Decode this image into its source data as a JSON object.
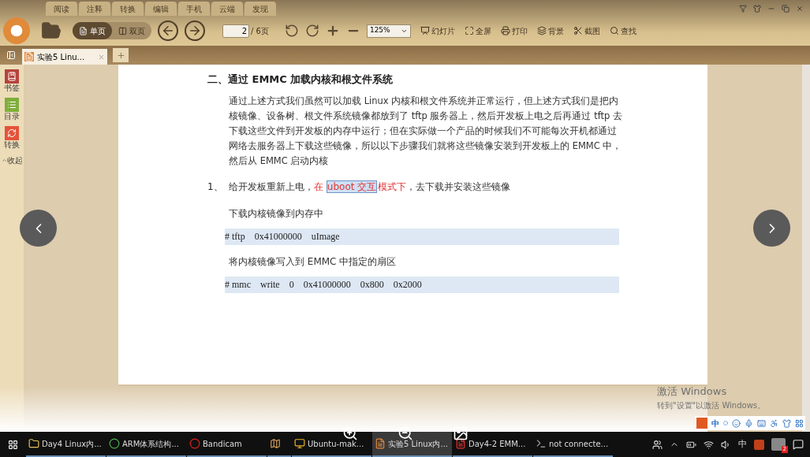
{
  "menu_tabs": [
    "阅读",
    "注释",
    "转换",
    "编辑",
    "手机",
    "云端",
    "发现"
  ],
  "toolbar": {
    "view_modes": [
      {
        "label": "单页",
        "selected": true
      },
      {
        "label": "双页",
        "selected": false
      }
    ],
    "page_input": "2",
    "page_total": "/ 6页",
    "zoom": "125%",
    "actions": [
      {
        "kind": "slideshow",
        "label": "幻灯片"
      },
      {
        "kind": "fullscreen",
        "label": "全屏"
      },
      {
        "kind": "print",
        "label": "打印"
      },
      {
        "kind": "background",
        "label": "背景"
      },
      {
        "kind": "screenshot",
        "label": "截图"
      },
      {
        "kind": "find",
        "label": "查找"
      }
    ]
  },
  "doc_tabs": [
    {
      "title": "实验5 Linu...",
      "selected": true
    }
  ],
  "sidebar": {
    "items": [
      {
        "kind": "bookmark",
        "label": "书签"
      },
      {
        "kind": "toc",
        "label": "目录"
      },
      {
        "kind": "convert",
        "label": "转换"
      }
    ],
    "collapse": "收起"
  },
  "document": {
    "heading": "二、通过 EMMC 加载内核和根文件系统",
    "paragraph": "通过上述方式我们虽然可以加载 Linux 内核和根文件系统并正常运行，但上述方式我们是把内核镜像、设备树、根文件系统镜像都放到了 tftp 服务器上，然后开发板上电之后再通过 tftp 去下载这些文件到开发板的内存中运行；但在实际做一个产品的时候我们不可能每次开机都通过网络去服务器上下载这些镜像，所以以下步骤我们就将这些镜像安装到开发板上的 EMMC 中，然后从 EMMC 启动内核",
    "step_number": "1、",
    "step": [
      {
        "kind": "plain",
        "text": "给开发板重新上电，"
      },
      {
        "kind": "annotated",
        "text": "在 "
      },
      {
        "kind": "selected",
        "text": "uboot 交互"
      },
      {
        "kind": "annotated",
        "text": "模式下"
      },
      {
        "kind": "plain",
        "text": "，去下载并安装这些镜像"
      }
    ],
    "blocks": [
      {
        "kind": "text",
        "text": "下载内核镜像到内存中"
      },
      {
        "kind": "code",
        "text": "# tftp    0x41000000    uImage"
      },
      {
        "kind": "text",
        "text": "将内核镜像写入到 EMMC 中指定的扇区"
      },
      {
        "kind": "code",
        "text": "# mmc    write    0    0x41000000    0x800    0x2000"
      }
    ]
  },
  "activation": {
    "title": "激活 Windows",
    "subtitle": "转到\"设置\"以激活 Windows。"
  },
  "ime_bar": {
    "mode": "中"
  },
  "taskbar": {
    "items": [
      {
        "kind": "folder",
        "label": "Day4 Linux内...",
        "selected": false
      },
      {
        "kind": "browser",
        "label": "ARM体系结构...",
        "selected": false
      },
      {
        "kind": "record",
        "label": "Bandicam",
        "selected": false
      },
      {
        "kind": "map",
        "selected": false
      },
      {
        "kind": "vm",
        "label": "Ubuntu-mak...",
        "selected": false
      },
      {
        "kind": "reader",
        "label": "实验5 Linux内...",
        "selected": true
      },
      {
        "kind": "wps",
        "label": "Day4-2 EMM...",
        "selected": false
      },
      {
        "kind": "terminal",
        "label": "not connecte...",
        "selected": false
      }
    ],
    "ime": "中",
    "notifications": "2"
  }
}
